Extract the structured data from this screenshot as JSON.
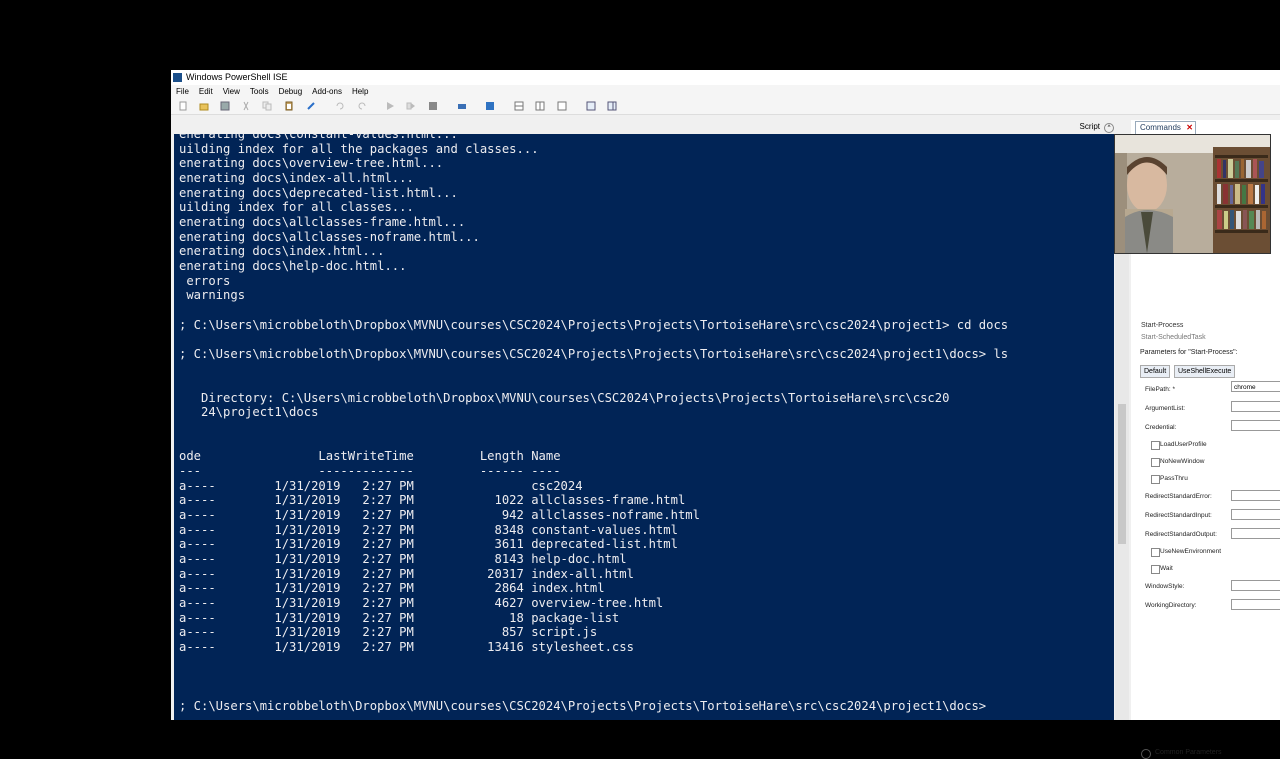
{
  "window": {
    "title": "Windows PowerShell ISE"
  },
  "menu": [
    "File",
    "Edit",
    "View",
    "Tools",
    "Debug",
    "Add-ons",
    "Help"
  ],
  "toolbar_icons": [
    "new-icon",
    "open-icon",
    "save-icon",
    "cut-icon",
    "copy-icon",
    "paste-icon",
    "clear-icon",
    "undo-icon",
    "redo-icon",
    "run-icon",
    "run-selection-icon",
    "stop-icon",
    "remote-icon",
    "powershell-icon",
    "layout-top-icon",
    "layout-right-icon",
    "layout-max-icon",
    "show-script-icon",
    "show-commands-icon"
  ],
  "script_tab": {
    "label": "Script"
  },
  "console": {
    "lines": [
      "enerating docs\\constant-values.html...",
      "uilding index for all the packages and classes...",
      "enerating docs\\overview-tree.html...",
      "enerating docs\\index-all.html...",
      "enerating docs\\deprecated-list.html...",
      "uilding index for all classes...",
      "enerating docs\\allclasses-frame.html...",
      "enerating docs\\allclasses-noframe.html...",
      "enerating docs\\index.html...",
      "enerating docs\\help-doc.html...",
      " errors",
      " warnings",
      "",
      "; C:\\Users\\microbbeloth\\Dropbox\\MVNU\\courses\\CSC2024\\Projects\\Projects\\TortoiseHare\\src\\csc2024\\project1> cd docs",
      "",
      "; C:\\Users\\microbbeloth\\Dropbox\\MVNU\\courses\\CSC2024\\Projects\\Projects\\TortoiseHare\\src\\csc2024\\project1\\docs> ls",
      "",
      "",
      "   Directory: C:\\Users\\microbbeloth\\Dropbox\\MVNU\\courses\\CSC2024\\Projects\\Projects\\TortoiseHare\\src\\csc20",
      "   24\\project1\\docs",
      "",
      "",
      "ode                LastWriteTime         Length Name",
      "---                -------------         ------ ----",
      "a----        1/31/2019   2:27 PM                csc2024",
      "a----        1/31/2019   2:27 PM           1022 allclasses-frame.html",
      "a----        1/31/2019   2:27 PM            942 allclasses-noframe.html",
      "a----        1/31/2019   2:27 PM           8348 constant-values.html",
      "a----        1/31/2019   2:27 PM           3611 deprecated-list.html",
      "a----        1/31/2019   2:27 PM           8143 help-doc.html",
      "a----        1/31/2019   2:27 PM          20317 index-all.html",
      "a----        1/31/2019   2:27 PM           2864 index.html",
      "a----        1/31/2019   2:27 PM           4627 overview-tree.html",
      "a----        1/31/2019   2:27 PM             18 package-list",
      "a----        1/31/2019   2:27 PM            857 script.js",
      "a----        1/31/2019   2:27 PM          13416 stylesheet.css",
      "",
      "",
      "",
      "; C:\\Users\\microbbeloth\\Dropbox\\MVNU\\courses\\CSC2024\\Projects\\Projects\\TortoiseHare\\src\\csc2024\\project1\\docs>"
    ]
  },
  "commands": {
    "tab_label": "Commands",
    "list": [
      "Start-Process",
      "Start-ScheduledTask"
    ],
    "params_title": "Parameters for \"Start-Process\":",
    "tabs": [
      "Default",
      "UseShellExecute"
    ],
    "fields": [
      {
        "label": "FilePath: *",
        "value": "chrome"
      },
      {
        "label": "ArgumentList:",
        "value": ""
      },
      {
        "label": "Credential:",
        "value": ""
      }
    ],
    "checkboxes": [
      "LoadUserProfile",
      "NoNewWindow",
      "PassThru"
    ],
    "fields2": [
      {
        "label": "RedirectStandardError:",
        "value": ""
      },
      {
        "label": "RedirectStandardInput:",
        "value": ""
      },
      {
        "label": "RedirectStandardOutput:",
        "value": ""
      }
    ],
    "checkboxes2": [
      "UseNewEnvironment",
      "Wait"
    ],
    "fields3": [
      {
        "label": "WindowStyle:",
        "value": ""
      },
      {
        "label": "WorkingDirectory:",
        "value": ""
      }
    ],
    "common_parameters": "Common Parameters"
  },
  "colors": {
    "console_bg": "#012456",
    "console_fg": "#eeedf0"
  }
}
